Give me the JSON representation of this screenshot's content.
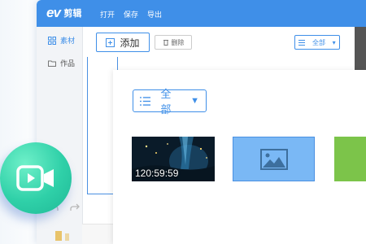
{
  "app": {
    "logo_ev": "ev",
    "logo_name": "剪辑"
  },
  "menu": {
    "items": [
      {
        "label": "打开"
      },
      {
        "label": "保存"
      },
      {
        "label": "导出"
      }
    ]
  },
  "sidebar": {
    "items": [
      {
        "label": "素材",
        "icon": "grid-icon",
        "active": true
      },
      {
        "label": "作品",
        "icon": "folder-icon",
        "active": false
      }
    ]
  },
  "toolbar": {
    "add_label": "添加",
    "delete_label": "删除",
    "filter_label": "全部"
  },
  "panel": {
    "filter_label": "全部",
    "thumbnails": [
      {
        "type": "video",
        "timecode": "120:59:59"
      },
      {
        "type": "image",
        "icon": "image-icon"
      },
      {
        "type": "green-clip"
      }
    ]
  },
  "colors": {
    "accent": "#3f8fe8",
    "image_thumb": "#7ab8f5",
    "green_thumb": "#7cc44a",
    "app_icon": "#2fd0a8"
  }
}
